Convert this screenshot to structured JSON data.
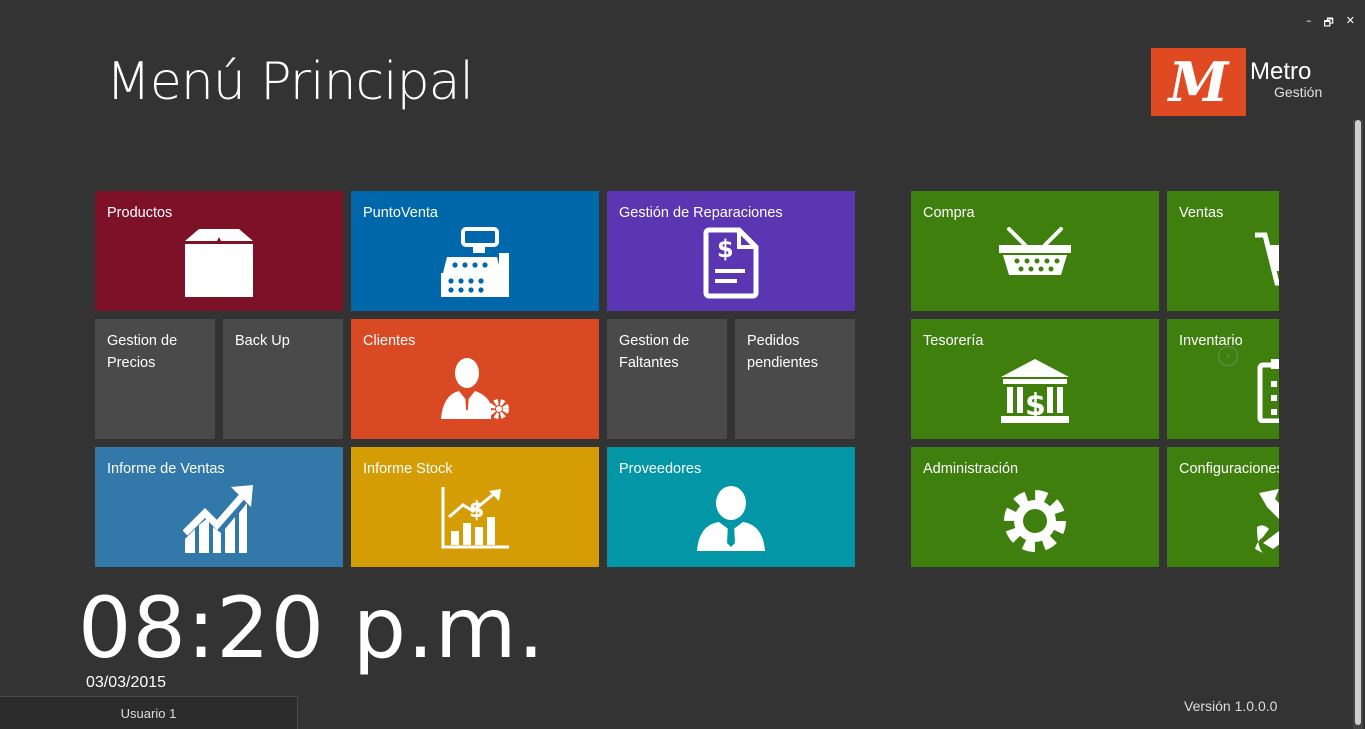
{
  "window": {
    "minimize": "–",
    "restore": "🗗",
    "close": "✕"
  },
  "header": {
    "title": "Menú Principal",
    "logo": {
      "mark": "M",
      "name": "Metro",
      "sub": "Gestión",
      "color": "#e04a22"
    }
  },
  "tiles": {
    "productos": {
      "label": "Productos",
      "color": "#7d1128",
      "icon": "box-icon"
    },
    "puntoventa": {
      "label": "PuntoVenta",
      "color": "#0067aa",
      "icon": "cash-register-icon"
    },
    "reparaciones": {
      "label": "Gestión de Reparaciones",
      "color": "#5b36b3",
      "icon": "invoice-document-icon"
    },
    "compra": {
      "label": "Compra",
      "color": "#3f7f0e",
      "icon": "basket-icon"
    },
    "ventas": {
      "label": "Ventas",
      "color": "#3f7f0e",
      "icon": "cart-icon"
    },
    "precios": {
      "label": "Gestion de\nPrecios",
      "color": "#4a4a4a"
    },
    "backup": {
      "label": "Back Up",
      "color": "#4a4a4a"
    },
    "clientes": {
      "label": "Clientes",
      "color": "#d94a24",
      "icon": "client-settings-icon"
    },
    "faltantes": {
      "label": "Gestion de\nFaltantes",
      "color": "#4a4a4a"
    },
    "pedidos": {
      "label": "Pedidos\npendientes",
      "color": "#4a4a4a"
    },
    "tesoreria": {
      "label": "Tesorería",
      "color": "#3f7f0e",
      "icon": "bank-icon"
    },
    "inventario": {
      "label": "Inventario",
      "color": "#3f7f0e",
      "icon": "clipboard-icon"
    },
    "informe_ventas": {
      "label": "Informe de Ventas",
      "color": "#3279aa",
      "icon": "growth-chart-icon"
    },
    "informe_stock": {
      "label": "Informe Stock",
      "color": "#d49d05",
      "icon": "stock-chart-icon"
    },
    "proveedores": {
      "label": "Proveedores",
      "color": "#0296a7",
      "icon": "person-icon"
    },
    "administracion": {
      "label": "Administración",
      "color": "#3f7f0e",
      "icon": "gear-icon"
    },
    "configuraciones": {
      "label": "Configuraciones",
      "color": "#3f7f0e",
      "icon": "tools-icon"
    }
  },
  "clock": {
    "time": "08:20 p.m.",
    "date": "03/03/2015"
  },
  "status": {
    "user": "Usuario 1",
    "version": "Versión 1.0.0.0"
  },
  "nav": {
    "next": "›"
  }
}
